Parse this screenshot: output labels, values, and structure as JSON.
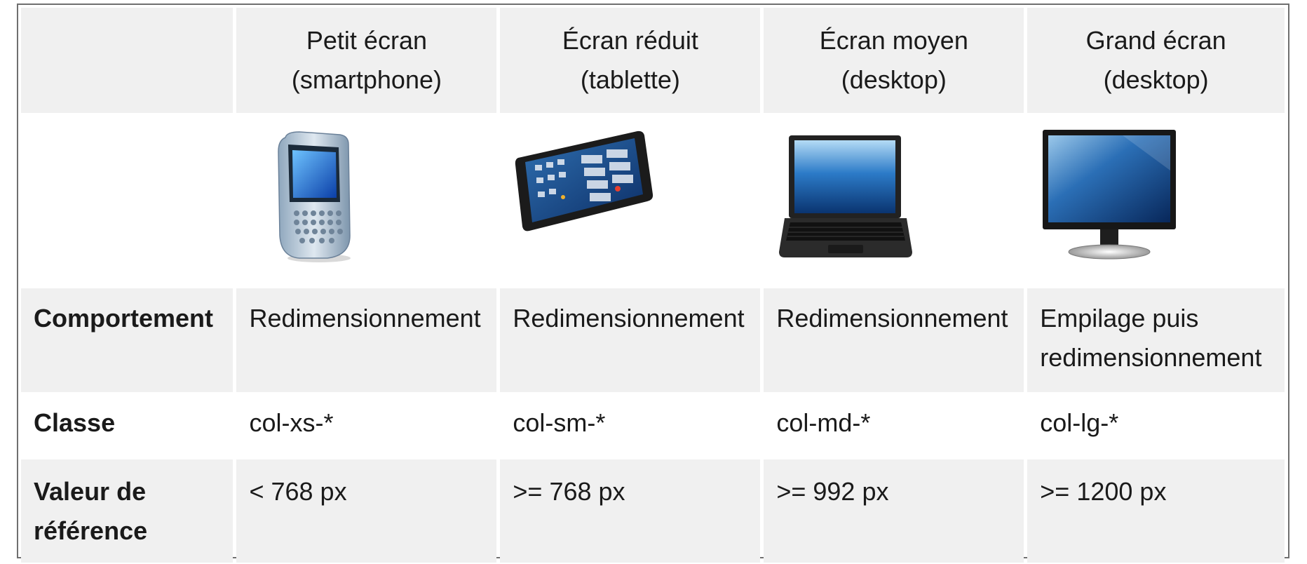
{
  "table": {
    "columns": [
      {
        "line1": "Petit écran",
        "line2": "(smartphone)",
        "device": "smartphone-icon"
      },
      {
        "line1": "Écran réduit",
        "line2": "(tablette)",
        "device": "tablet-icon"
      },
      {
        "line1": "Écran moyen",
        "line2": "(desktop)",
        "device": "laptop-icon"
      },
      {
        "line1": "Grand écran",
        "line2": "(desktop)",
        "device": "monitor-icon"
      }
    ],
    "rows": [
      {
        "label": "Comportement",
        "values": [
          "Redimensionnement",
          "Redimensionnement",
          "Redimensionnement",
          "Empilage puis redimensionnement"
        ]
      },
      {
        "label": "Classe",
        "values": [
          "col-xs-*",
          "col-sm-*",
          "col-md-*",
          "col-lg-*"
        ]
      },
      {
        "label": "Valeur de référence",
        "values": [
          "< 768 px",
          ">= 768 px",
          ">= 992 px",
          ">= 1200 px"
        ]
      }
    ]
  },
  "colors": {
    "header_bg": "#f0f0f0",
    "row_bg_alt": "#ffffff",
    "border": "#6f6f6f",
    "device_blue": "#1e6fd0"
  }
}
